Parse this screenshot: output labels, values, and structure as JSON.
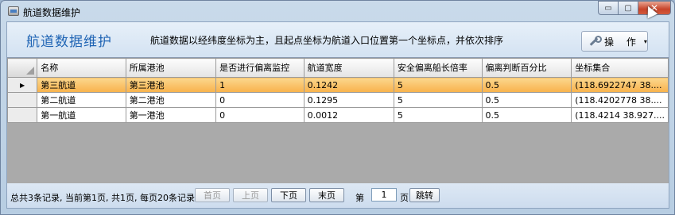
{
  "window": {
    "title": "航道数据维护"
  },
  "header": {
    "title": "航道数据维护",
    "description": "航道数据以经纬度坐标为主，且起点坐标为航道入口位置第一个坐标点，并依次排序",
    "operate_label": "操 作",
    "operate_caret": "▾"
  },
  "table": {
    "columns": [
      "名称",
      "所属港池",
      "是否进行偏离监控",
      "航道宽度",
      "安全偏离船长倍率",
      "偏离判断百分比",
      "坐标集合"
    ],
    "rows": [
      [
        "第三航道",
        "第三港池",
        "1",
        "0.1242",
        "5",
        "0.5",
        "(118.6922747 38...."
      ],
      [
        "第二航道",
        "第二港池",
        "0",
        "0.1295",
        "5",
        "0.5",
        "(118.4202778 38...."
      ],
      [
        "第一航道",
        "第一港池",
        "0",
        "0.0012",
        "5",
        "0.5",
        "(118.4214 38.927...."
      ]
    ],
    "selected_row_marker": "▶"
  },
  "pager": {
    "info": "总共3条记录, 当前第1页, 共1页, 每页20条记录",
    "first": "首页",
    "prev": "上页",
    "next": "下页",
    "last": "末页",
    "page_prefix": "第",
    "page_value": "1",
    "page_suffix": "页",
    "go": "跳转"
  },
  "titlebar_buttons": {
    "minimize": "▭",
    "maximize": "▢",
    "close": "✕"
  }
}
